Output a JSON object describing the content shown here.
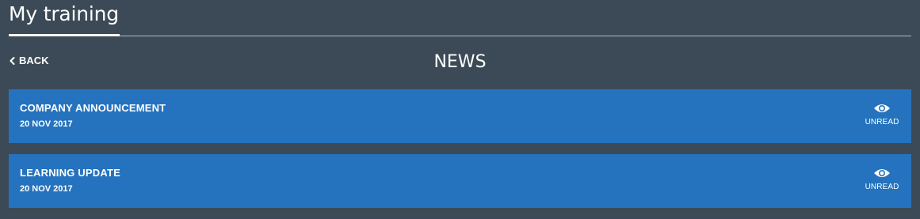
{
  "header": {
    "title": "My training"
  },
  "nav": {
    "back_label": "BACK",
    "back_icon": "chevron-left-icon"
  },
  "section": {
    "title": "NEWS"
  },
  "news": {
    "items": [
      {
        "title": "COMPANY ANNOUNCEMENT",
        "date": "20 NOV 2017",
        "status": "UNREAD",
        "status_icon": "eye-icon"
      },
      {
        "title": "LEARNING UPDATE",
        "date": "20 NOV 2017",
        "status": "UNREAD",
        "status_icon": "eye-icon"
      }
    ]
  },
  "colors": {
    "background": "#3b4a56",
    "card": "#2573be",
    "text": "#ffffff"
  }
}
